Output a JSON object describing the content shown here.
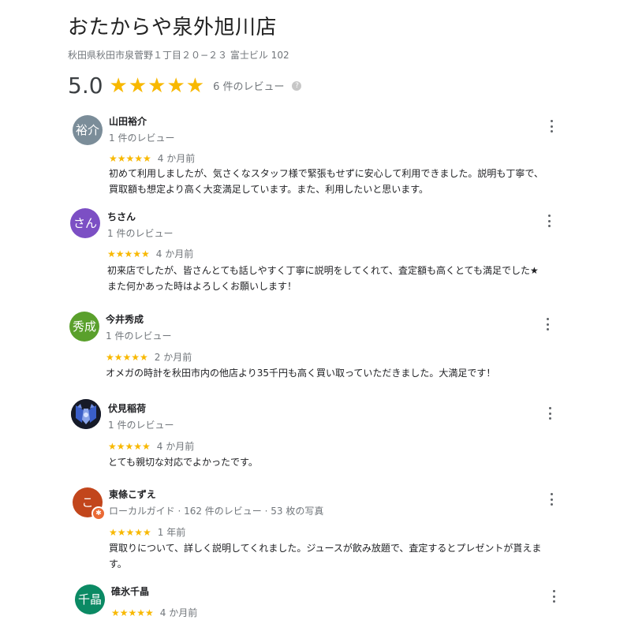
{
  "header": {
    "title": "おたからや泉外旭川店",
    "address": "秋田県秋田市泉菅野１丁目２０−２３ 富士ビル 102"
  },
  "summary": {
    "score": "5.0",
    "stars": "★★★★★",
    "review_count": "6 件のレビュー",
    "help_icon": "?"
  },
  "colors": {
    "star": "#f8b800",
    "avatar_yusuke": "#7b8d99",
    "avatar_chisan": "#7c4fc4",
    "avatar_hidenari": "#5aa02c",
    "avatar_kozue": "#c2461c",
    "avatar_chiaki": "#0b8a64"
  },
  "reviews": [
    {
      "avatar_text": "裕介",
      "name": "山田裕介",
      "sub": "1 件のレビュー",
      "stars": "★★★★★",
      "time": "4 か月前",
      "text_lines": [
        "初めて利用しましたが、気さくなスタッフ様で緊張もせずに安心して利用できました。説明も丁寧で、",
        "買取額も想定より高く大変満足しています。また、利用したいと思います。"
      ]
    },
    {
      "avatar_text": "さん",
      "name": "ちさん",
      "sub": "1 件のレビュー",
      "stars": "★★★★★",
      "time": "4 か月前",
      "text_lines": [
        "初来店でしたが、皆さんとても話しやすく丁寧に説明をしてくれて、査定額も高くとても満足でした★",
        "また何かあった時はよろしくお願いします！"
      ]
    },
    {
      "avatar_text": "秀成",
      "name": "今井秀成",
      "sub": "1 件のレビュー",
      "stars": "★★★★★",
      "time": "2 か月前",
      "text_lines": [
        "オメガの時計を秋田市内の他店より35千円も高く買い取っていただきました。大満足です！"
      ]
    },
    {
      "avatar_text": "",
      "name": "伏見稲荷",
      "sub": "1 件のレビュー",
      "stars": "★★★★★",
      "time": "4 か月前",
      "text_lines": [
        "とても親切な対応でよかったです。"
      ]
    },
    {
      "avatar_text": "こ",
      "name": "東條こずえ",
      "sub": "ローカルガイド · 162 件のレビュー · 53 枚の写真",
      "stars": "★★★★★",
      "time": "1 年前",
      "text_lines": [
        "買取りについて、詳しく説明してくれました。ジュースが飲み放題で、査定するとプレゼントが貰えま",
        "す。"
      ]
    },
    {
      "avatar_text": "千晶",
      "name": "碓氷千晶",
      "sub": "",
      "stars": "★★★★★",
      "time": "4 か月前",
      "text_lines": []
    }
  ]
}
